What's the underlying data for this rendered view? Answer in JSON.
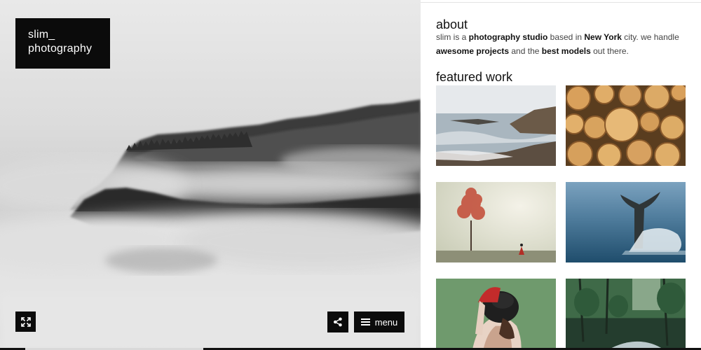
{
  "brand": {
    "line1": "slim_",
    "line2": "photography"
  },
  "hero": {
    "expand_icon": "expand-arrows-icon",
    "share_icon": "share-icon",
    "menu_label": "menu",
    "menu_icon": "hamburger-icon"
  },
  "about": {
    "heading": "about",
    "t1": "slim is a ",
    "b1": "photography studio",
    "t2": " based in ",
    "b2": "New York",
    "t3": " city. we handle ",
    "b3": "awesome projects",
    "t4": " and the ",
    "b4": "best models",
    "t5": " out there."
  },
  "featured": {
    "heading": "featured work",
    "items": [
      {
        "subject": "rocky coastline"
      },
      {
        "subject": "stacked logs"
      },
      {
        "subject": "red tree in fog"
      },
      {
        "subject": "whale tail"
      },
      {
        "subject": "woman with red glove and hat"
      },
      {
        "subject": "forest stream"
      }
    ]
  },
  "colors": {
    "black": "#0b0b0b",
    "text": "#444444",
    "heading": "#111111"
  }
}
